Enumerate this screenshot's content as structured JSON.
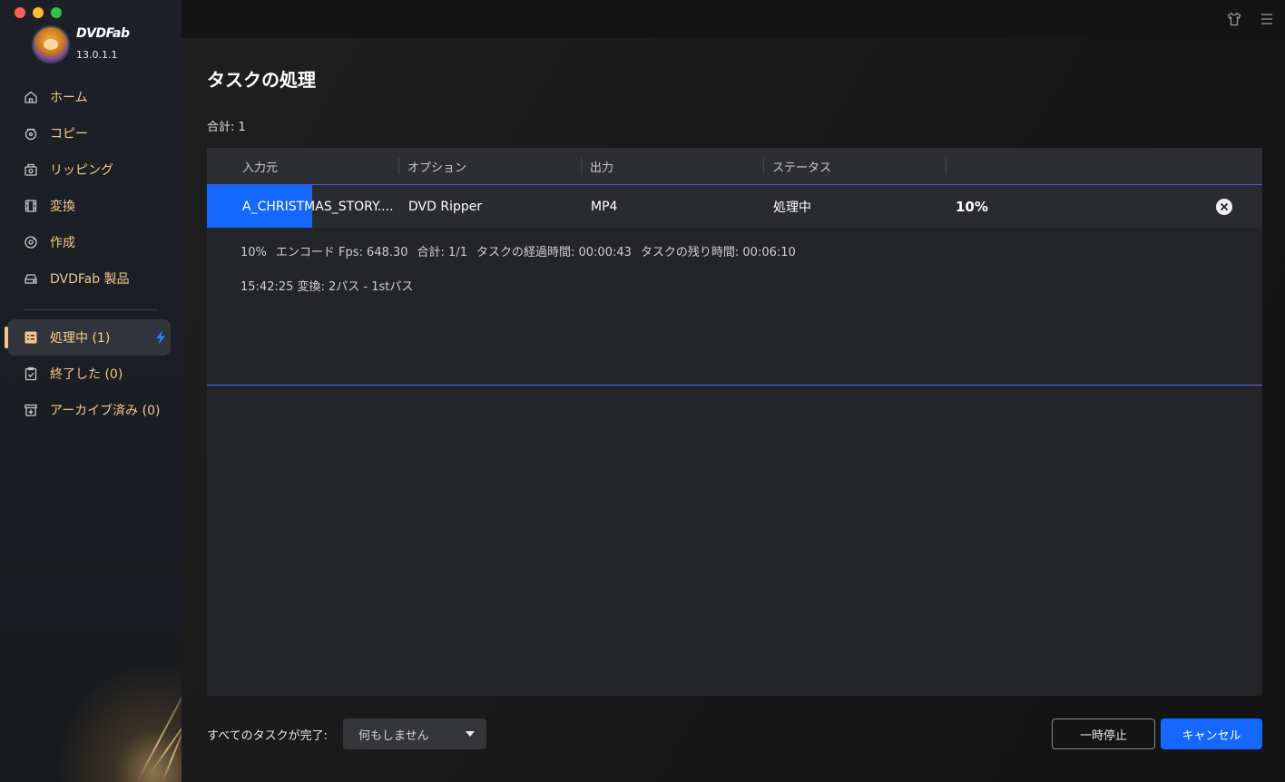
{
  "app": {
    "brand": "DVDFab",
    "version": "13.0.1.1"
  },
  "sidebar": {
    "items": [
      {
        "label": "ホーム",
        "icon": "home-icon"
      },
      {
        "label": "コピー",
        "icon": "copy-disc-icon"
      },
      {
        "label": "リッピング",
        "icon": "ripper-icon"
      },
      {
        "label": "変換",
        "icon": "film-icon"
      },
      {
        "label": "作成",
        "icon": "creator-disc-icon"
      },
      {
        "label": "DVDFab 製品",
        "icon": "drive-icon"
      }
    ],
    "queue": [
      {
        "label": "処理中 (1)",
        "icon": "task-list-icon",
        "active": true
      },
      {
        "label": "終了した (0)",
        "icon": "clipboard-check-icon"
      },
      {
        "label": "アーカイブ済み (0)",
        "icon": "archive-icon"
      }
    ]
  },
  "topbar": {
    "icons": [
      "shirt-skin-icon",
      "menu-icon"
    ]
  },
  "page": {
    "title": "タスクの処理",
    "total": "合計: 1"
  },
  "table": {
    "headers": [
      "入力元",
      "オプション",
      "出力",
      "ステータス",
      ""
    ],
    "task": {
      "input": "A_CHRISTMAS_STORY....",
      "option": "DVD Ripper",
      "output": "MP4",
      "status": "処理中",
      "percent": "10%",
      "progress": 0.1
    },
    "detail": {
      "percent": "10%",
      "fps": "エンコード Fps: 648.30",
      "count": "合計: 1/1",
      "elapsed": "タスクの経過時間: 00:00:43",
      "remaining": "タスクの残り時間: 00:06:10",
      "log": "15:42:25  変換: 2パス - 1stパス"
    }
  },
  "footer": {
    "after_label": "すべてのタスクが完了:",
    "after_value": "何もしません",
    "pause_label": "一時停止",
    "cancel_label": "キャンセル"
  },
  "colors": {
    "accent": "#1467ff",
    "nav_text": "#f1c98c",
    "row_border": "#5b4fe0"
  }
}
